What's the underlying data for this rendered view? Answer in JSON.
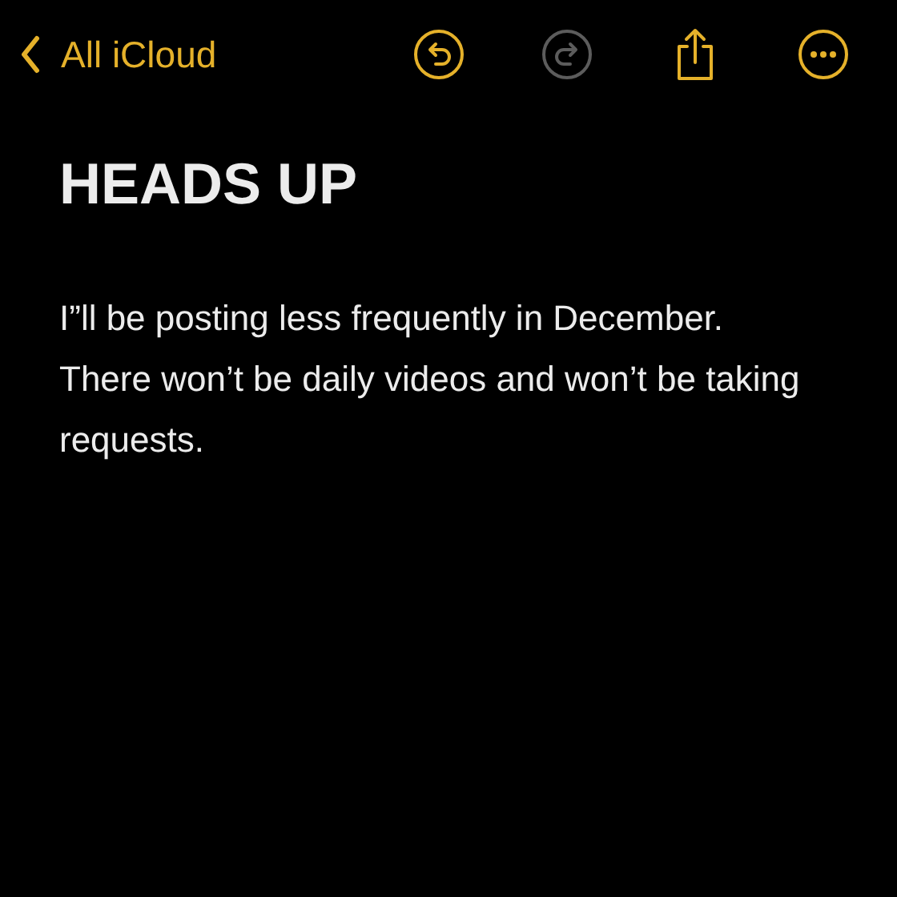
{
  "nav": {
    "back_label": "All iCloud"
  },
  "toolbar": [
    {
      "kind": "undo",
      "disabled": false
    },
    {
      "kind": "redo",
      "disabled": true
    },
    {
      "kind": "share",
      "disabled": false
    },
    {
      "kind": "more",
      "disabled": false
    }
  ],
  "note": {
    "title": "HEADS UP",
    "body": "I”ll be posting less frequently in December. There won’t be daily videos and won’t be taking requests."
  }
}
